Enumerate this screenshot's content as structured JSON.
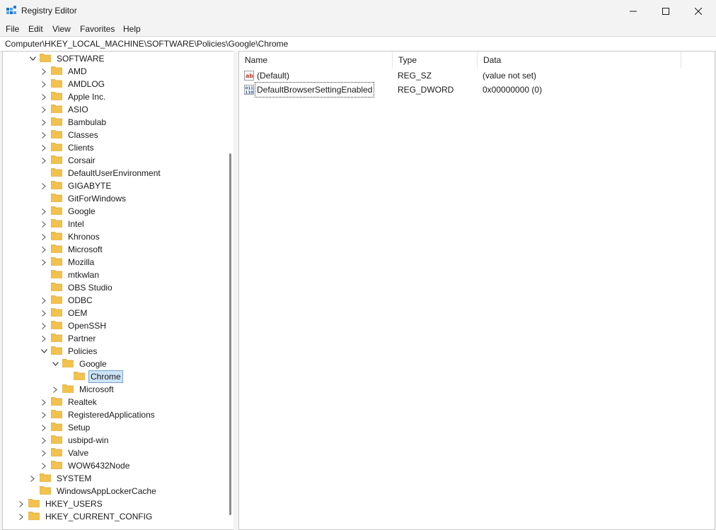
{
  "window": {
    "title": "Registry Editor",
    "icon": "regedit-icon",
    "controls": [
      "minimize-icon",
      "maximize-icon",
      "close-icon"
    ]
  },
  "menu": [
    "File",
    "Edit",
    "View",
    "Favorites",
    "Help"
  ],
  "address": "Computer\\HKEY_LOCAL_MACHINE\\SOFTWARE\\Policies\\Google\\Chrome",
  "tree": {
    "software": "SOFTWARE",
    "software_children": [
      "AMD",
      "AMDLOG",
      "Apple Inc.",
      "ASIO",
      "Bambulab",
      "Classes",
      "Clients",
      "Corsair",
      "DefaultUserEnvironment",
      "GIGABYTE",
      "GitForWindows",
      "Google",
      "Intel",
      "Khronos",
      "Microsoft",
      "Mozilla",
      "mtkwlan",
      "OBS Studio",
      "ODBC",
      "OEM",
      "OpenSSH",
      "Partner"
    ],
    "policies": "Policies",
    "google": "Google",
    "chrome": "Chrome",
    "policies_microsoft": "Microsoft",
    "software_after": [
      "Realtek",
      "RegisteredApplications",
      "Setup",
      "usbipd-win",
      "Valve",
      "WOW6432Node"
    ],
    "system": "SYSTEM",
    "applocker": "WindowsAppLockerCache",
    "hkey_users": "HKEY_USERS",
    "hkey_current_config": "HKEY_CURRENT_CONFIG",
    "no_chevron": [
      "DefaultUserEnvironment",
      "GitForWindows",
      "mtkwlan",
      "OBS Studio",
      "WindowsAppLockerCache"
    ]
  },
  "columns": {
    "name": "Name",
    "type": "Type",
    "data": "Data"
  },
  "values": [
    {
      "name": "(Default)",
      "type": "REG_SZ",
      "data": "(value not set)",
      "icon": "string-value-icon"
    },
    {
      "name": "DefaultBrowserSettingEnabled",
      "type": "REG_DWORD",
      "data": "0x00000000 (0)",
      "icon": "binary-value-icon"
    }
  ],
  "colors": {
    "folder": "#f2c14e",
    "folder_dark": "#d9a52e",
    "selection": "#cce4f7",
    "accent": "#0067c0"
  }
}
